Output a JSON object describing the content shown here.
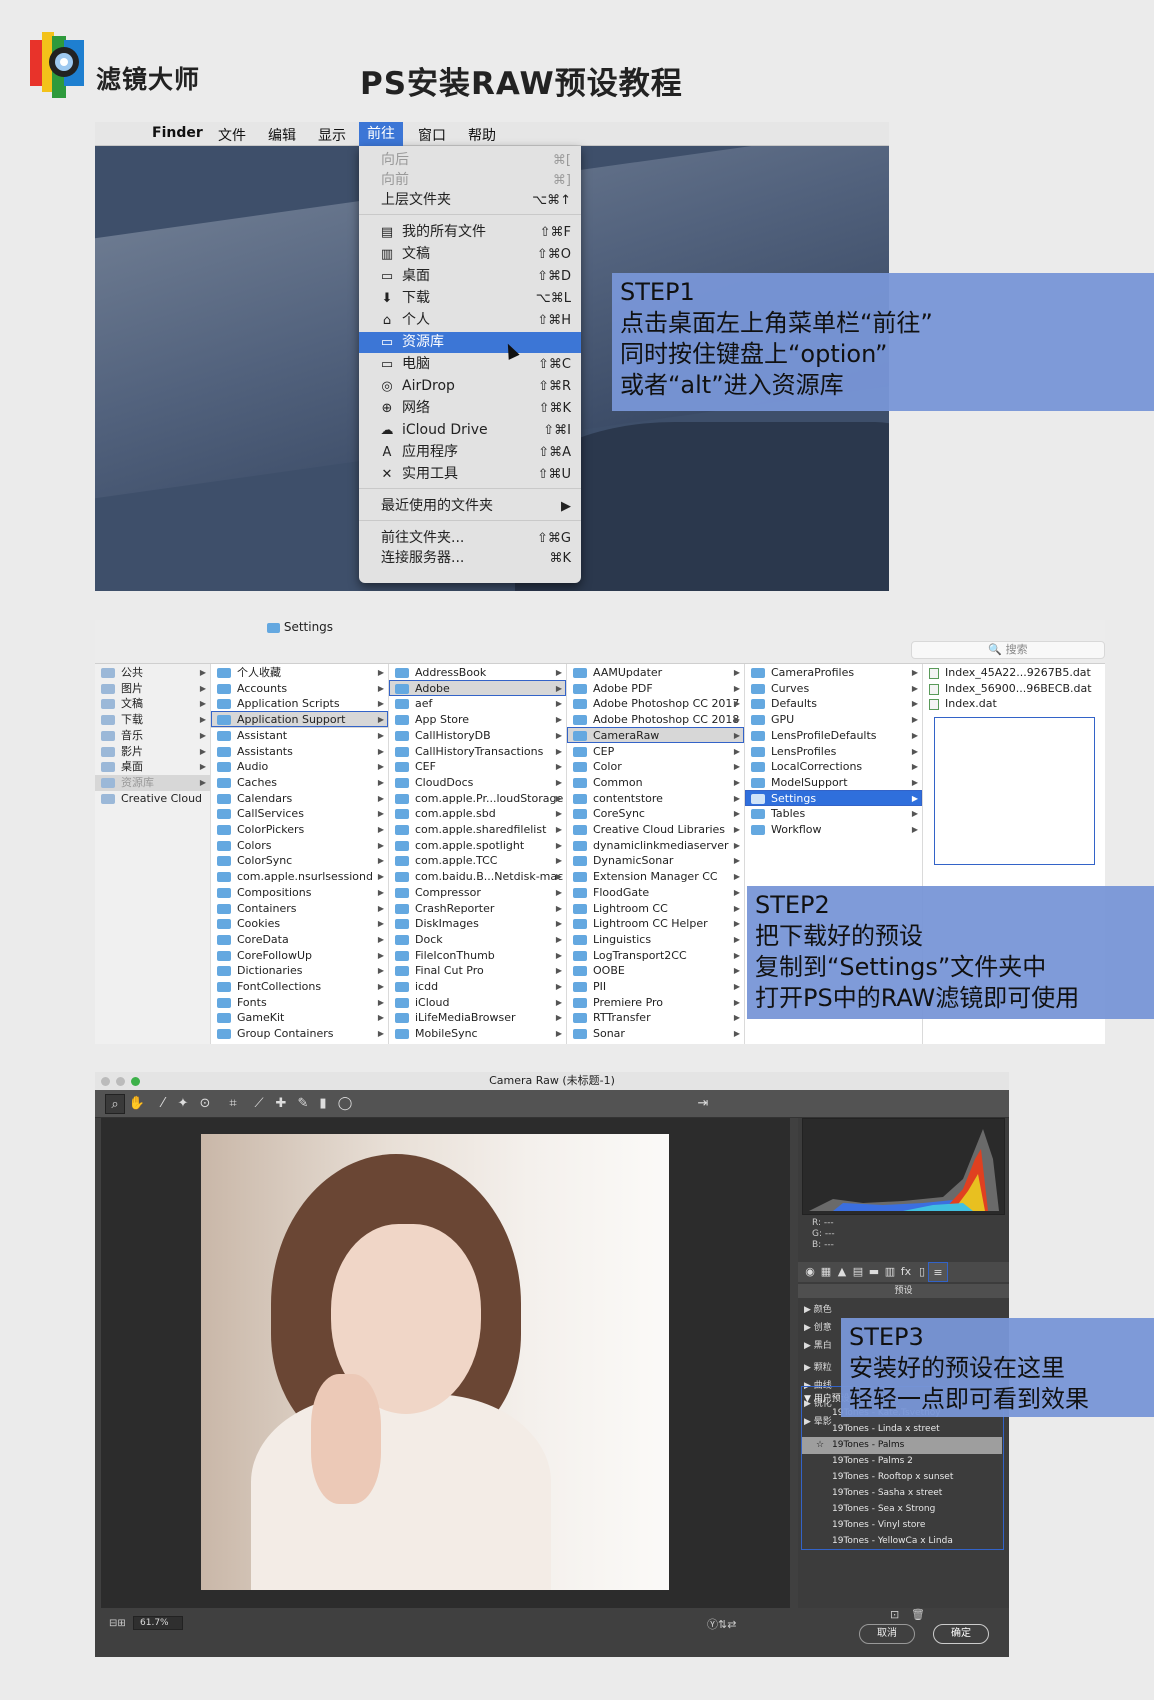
{
  "header": {
    "brand": "滤镜大师",
    "title": "PS安装RAW预设教程"
  },
  "menubar": {
    "apple": "",
    "items": [
      "Finder",
      "文件",
      "编辑",
      "显示",
      "前往",
      "窗口",
      "帮助"
    ]
  },
  "gomenu": {
    "items": [
      {
        "label": "向后",
        "shortcut": "⌘[",
        "icon": ""
      },
      {
        "label": "向前",
        "shortcut": "⌘]",
        "icon": ""
      },
      {
        "label": "上层文件夹",
        "shortcut": "⌥⌘↑",
        "icon": ""
      },
      {
        "label": "我的所有文件",
        "shortcut": "⇧⌘F",
        "icon": "▤"
      },
      {
        "label": "文稿",
        "shortcut": "⇧⌘O",
        "icon": "▥"
      },
      {
        "label": "桌面",
        "shortcut": "⇧⌘D",
        "icon": "▭"
      },
      {
        "label": "下载",
        "shortcut": "⌥⌘L",
        "icon": "⬇"
      },
      {
        "label": "个人",
        "shortcut": "⇧⌘H",
        "icon": "⌂"
      },
      {
        "label": "资源库",
        "shortcut": "",
        "icon": "▭"
      },
      {
        "label": "电脑",
        "shortcut": "⇧⌘C",
        "icon": "▭"
      },
      {
        "label": "AirDrop",
        "shortcut": "⇧⌘R",
        "icon": "◎"
      },
      {
        "label": "网络",
        "shortcut": "⇧⌘K",
        "icon": "⊕"
      },
      {
        "label": "iCloud Drive",
        "shortcut": "⇧⌘I",
        "icon": "☁"
      },
      {
        "label": "应用程序",
        "shortcut": "⇧⌘A",
        "icon": "A"
      },
      {
        "label": "实用工具",
        "shortcut": "⇧⌘U",
        "icon": "✕"
      },
      {
        "label": "最近使用的文件夹",
        "shortcut": "▶",
        "icon": ""
      },
      {
        "label": "前往文件夹...",
        "shortcut": "⇧⌘G",
        "icon": ""
      },
      {
        "label": "连接服务器...",
        "shortcut": "⌘K",
        "icon": ""
      }
    ]
  },
  "step1": {
    "l1": "STEP1",
    "l2": "点击桌面左上角菜单栏“前往”",
    "l3": "同时按住键盘上“option”",
    "l4": "或者“alt”进入资源库"
  },
  "finder": {
    "path": "Settings",
    "search": "🔍 搜索",
    "col1": [
      "公共",
      "图片",
      "文稿",
      "下载",
      "音乐",
      "影片",
      "桌面",
      "资源库",
      "Creative Cloud"
    ],
    "col2": [
      "个人收藏",
      "Accounts",
      "Application Scripts",
      "Application Support",
      "Assistant",
      "Assistants",
      "Audio",
      "Caches",
      "Calendars",
      "CallServices",
      "ColorPickers",
      "Colors",
      "ColorSync",
      "com.apple.nsurlsessiond",
      "Compositions",
      "Containers",
      "Cookies",
      "CoreData",
      "CoreFollowUp",
      "Dictionaries",
      "FontCollections",
      "Fonts",
      "GameKit",
      "Group Containers"
    ],
    "col3": [
      "AddressBook",
      "Adobe",
      "aef",
      "App Store",
      "CallHistoryDB",
      "CallHistoryTransactions",
      "CEF",
      "CloudDocs",
      "com.apple.Pr...loudStorage",
      "com.apple.sbd",
      "com.apple.sharedfilelist",
      "com.apple.spotlight",
      "com.apple.TCC",
      "com.baidu.B...Netdisk-mac",
      "Compressor",
      "CrashReporter",
      "DiskImages",
      "Dock",
      "FileIconThumb",
      "Final Cut Pro",
      "icdd",
      "iCloud",
      "iLifeMediaBrowser",
      "MobileSync"
    ],
    "col4": [
      "AAMUpdater",
      "Adobe PDF",
      "Adobe Photoshop CC 2017",
      "Adobe Photoshop CC 2018",
      "CameraRaw",
      "CEP",
      "Color",
      "Common",
      "contentstore",
      "CoreSync",
      "Creative Cloud Libraries",
      "dynamiclinkmediaserver",
      "DynamicSonar",
      "Extension Manager CC",
      "FloodGate",
      "Lightroom CC",
      "Lightroom CC Helper",
      "Linguistics",
      "LogTransport2CC",
      "OOBE",
      "PII",
      "Premiere Pro",
      "RTTransfer",
      "Sonar"
    ],
    "col5": [
      "CameraProfiles",
      "Curves",
      "Defaults",
      "GPU",
      "LensProfileDefaults",
      "LensProfiles",
      "LocalCorrections",
      "ModelSupport",
      "Settings",
      "Tables",
      "Workflow"
    ],
    "col6": [
      "Index_45A22...9267B5.dat",
      "Index_56900...96BECB.dat",
      "Index.dat"
    ]
  },
  "step2": {
    "l1": "STEP2",
    "l2": "把下载好的预设",
    "l3": "复制到“Settings”文件夹中",
    "l4": "打开PS中的RAW滤镜即可使用"
  },
  "camraw": {
    "title": "Camera Raw (未标题-1)",
    "zoom": "61.7%",
    "rgb": [
      "R:  ---",
      "G:  ---",
      "B:  ---"
    ],
    "panel_title": "预设",
    "groups": [
      "颜色",
      "创意",
      "黑白",
      "颗粒",
      "曲线",
      "锐化",
      "晕影"
    ],
    "user_group": "用户预设",
    "user_presets": [
      "19Tones - Kate.Tsvetnoy",
      "19Tones - Linda x street",
      "19Tones - Palms",
      "19Tones - Palms 2",
      "19Tones - Rooftop x sunset",
      "19Tones - Sasha x street",
      "19Tones - Sea x Strong",
      "19Tones - Vinyl store",
      "19Tones - YellowCa x Linda"
    ],
    "cancel": "取消",
    "ok": "确定"
  },
  "step3": {
    "l1": "STEP3",
    "l2": "安装好的预设在这里",
    "l3": "轻轻一点即可看到效果"
  },
  "colors": {
    "accent": "#3c76d6",
    "step_bg": "#7896d7",
    "outline": "#3363c8"
  }
}
